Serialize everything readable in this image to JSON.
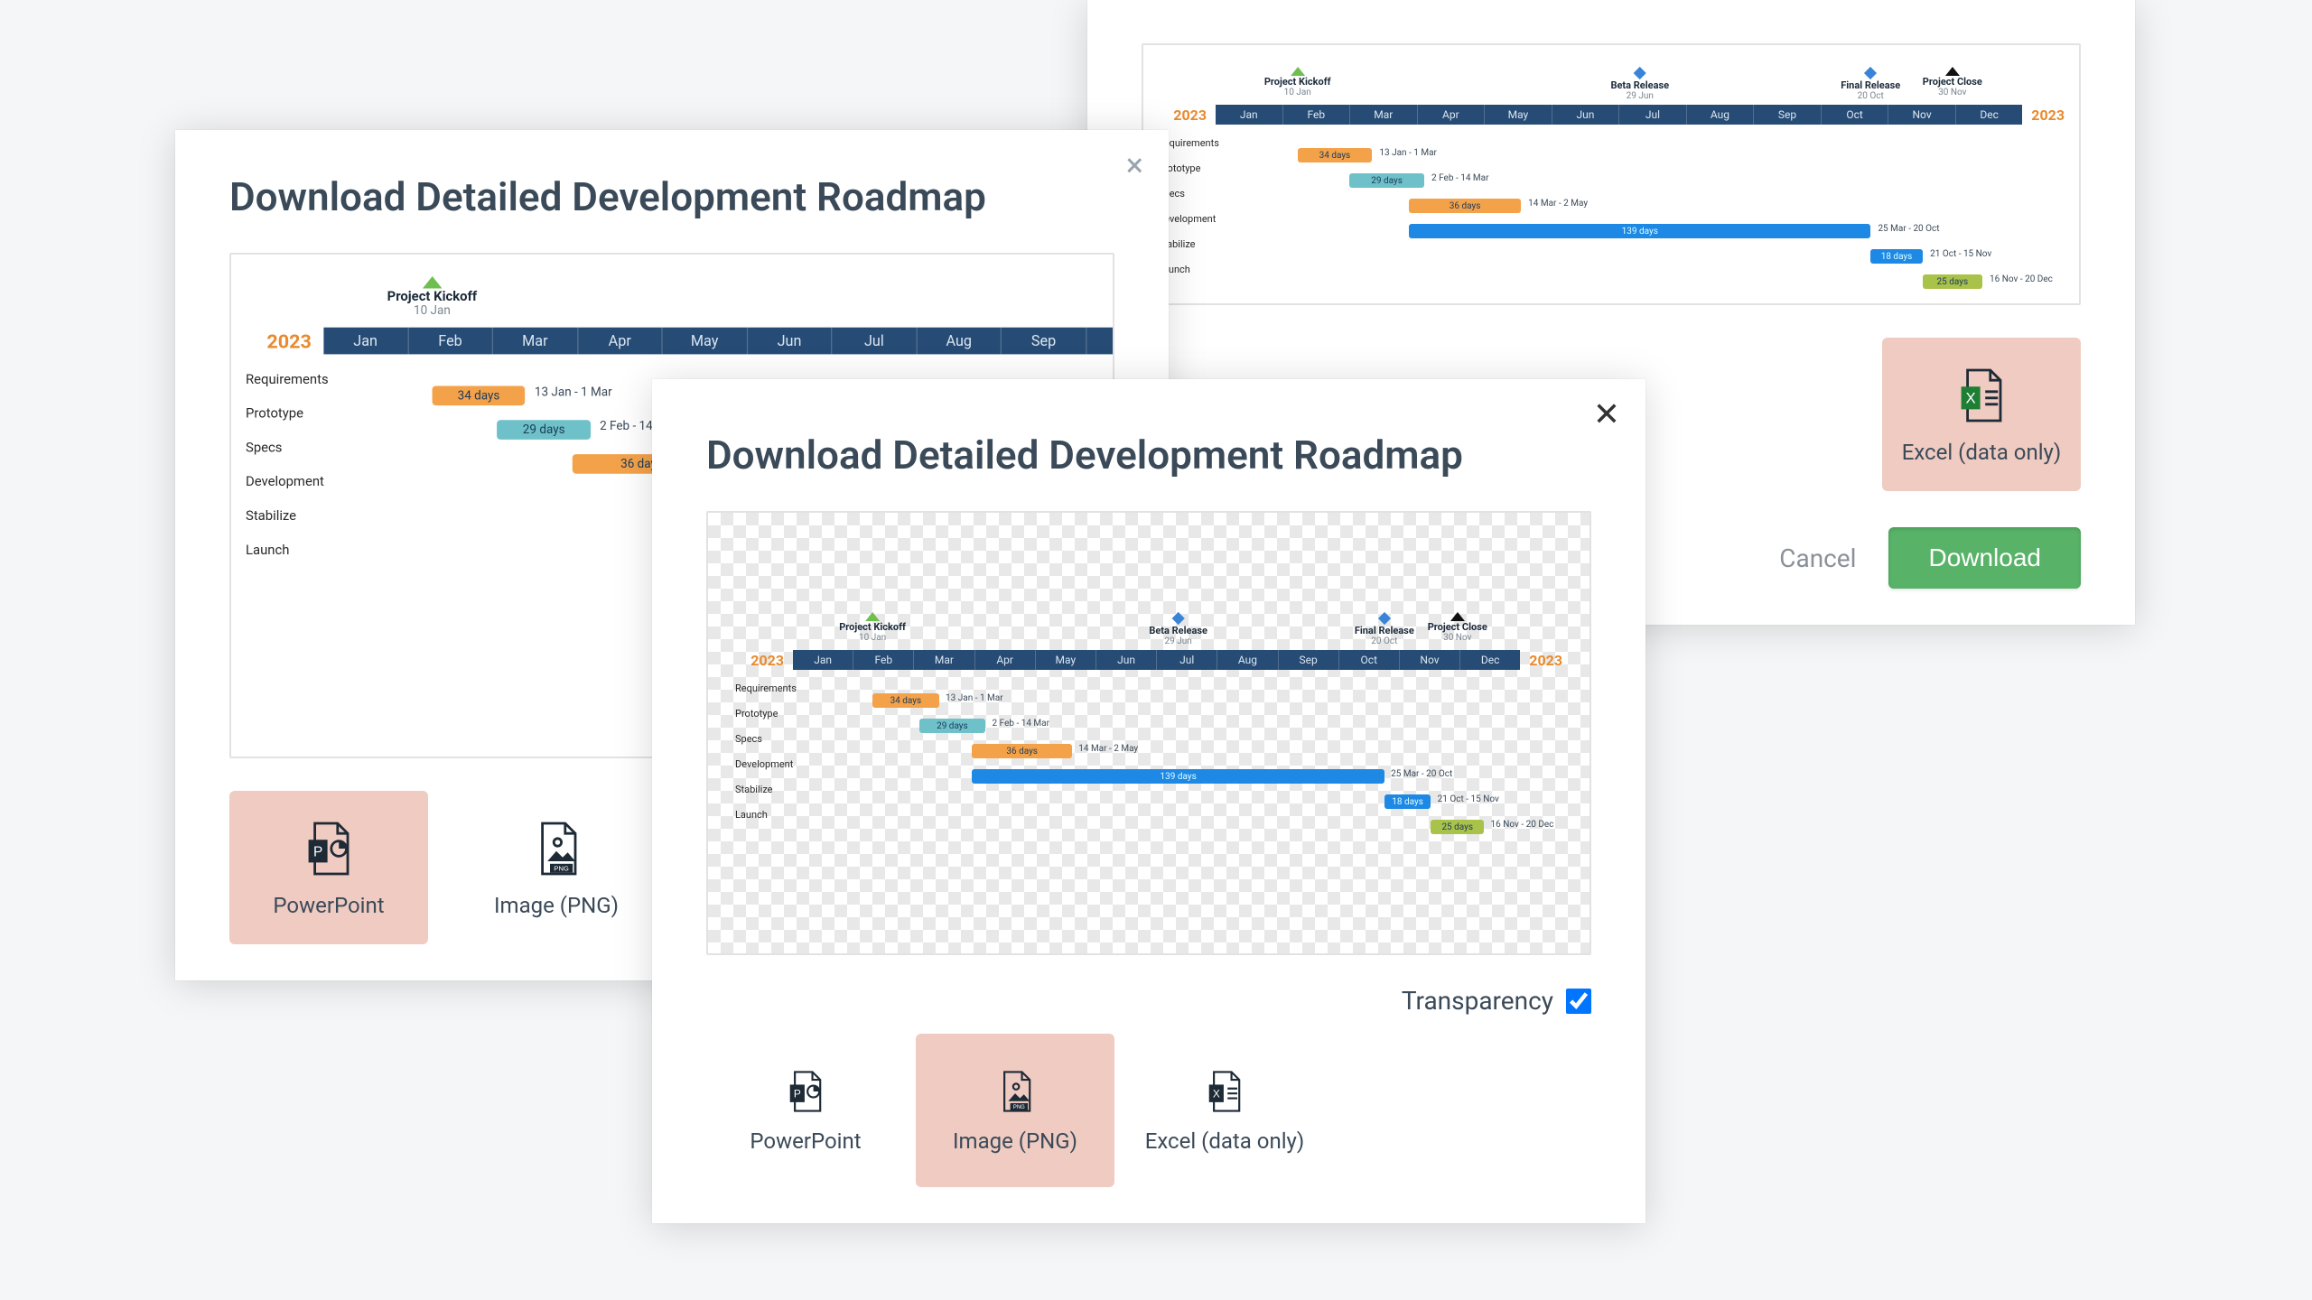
{
  "dialog_title": "Download Detailed Development Roadmap",
  "export_options": {
    "powerpoint": "PowerPoint",
    "image_png": "Image (PNG)",
    "excel": "Excel (data only)"
  },
  "transparency_label": "Transparency",
  "transparency_checked": true,
  "buttons": {
    "cancel": "Cancel",
    "download": "Download"
  },
  "chart_data": {
    "type": "gantt",
    "year": "2023",
    "months": [
      "Jan",
      "Feb",
      "Mar",
      "Apr",
      "May",
      "Jun",
      "Jul",
      "Aug",
      "Sep",
      "Oct",
      "Nov",
      "Dec"
    ],
    "milestones": [
      {
        "label": "Project Kickoff",
        "date": "10 Jan",
        "pos_pct": 3,
        "style": "green"
      },
      {
        "label": "Beta Release",
        "date": "29 Jun",
        "pos_pct": 49,
        "style": "diamond"
      },
      {
        "label": "Final Release",
        "date": "20 Oct",
        "pos_pct": 80,
        "style": "diamond"
      },
      {
        "label": "Project Close",
        "date": "30 Nov",
        "pos_pct": 91,
        "style": "black"
      }
    ],
    "tasks": [
      {
        "name": "Requirements",
        "start_pct": 3,
        "width_pct": 10,
        "color": "orange",
        "bar_label": "34 days",
        "range": "13 Jan - 1 Mar"
      },
      {
        "name": "Prototype",
        "start_pct": 10,
        "width_pct": 10,
        "color": "teal",
        "bar_label": "29 days",
        "range": "2 Feb - 14 Mar"
      },
      {
        "name": "Specs",
        "start_pct": 18,
        "width_pct": 15,
        "color": "orange",
        "bar_label": "36 days",
        "range": "14 Mar - 2 May"
      },
      {
        "name": "Development",
        "start_pct": 18,
        "width_pct": 62,
        "color": "blue",
        "bar_label": "139 days",
        "range": "25 Mar - 20 Oct"
      },
      {
        "name": "Stabilize",
        "start_pct": 80,
        "width_pct": 7,
        "color": "blue",
        "bar_label": "18 days",
        "range": "21 Oct - 15 Nov"
      },
      {
        "name": "Launch",
        "start_pct": 87,
        "width_pct": 8,
        "color": "olive",
        "bar_label": "25 days",
        "range": "16 Nov - 20 Dec"
      }
    ]
  },
  "dialog_back_left": {
    "selected": "powerpoint",
    "gantt_cut_months": 5,
    "gantt_cut_tasks": 6
  },
  "dialog_back_right": {
    "selected": "excel"
  },
  "dialog_front": {
    "selected": "image_png"
  }
}
